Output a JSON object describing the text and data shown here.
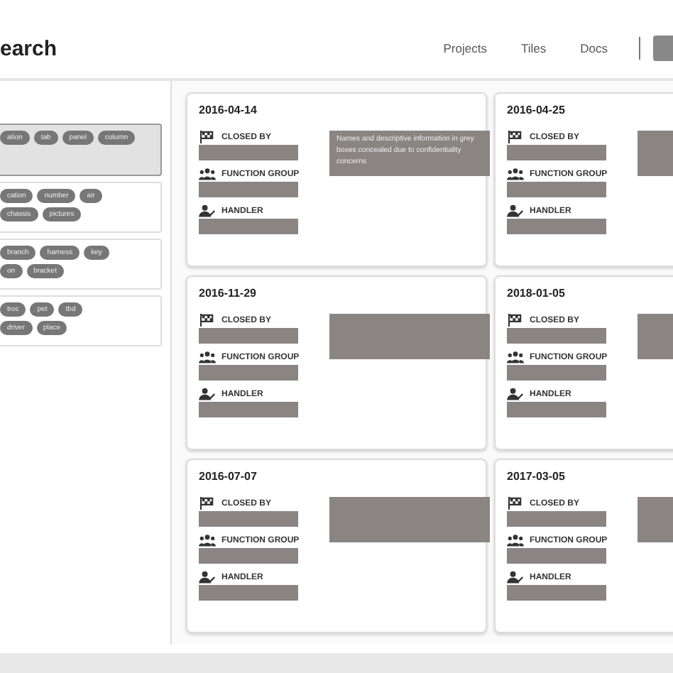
{
  "header": {
    "title": "earch",
    "nav": [
      "Projects",
      "Tiles",
      "Docs"
    ]
  },
  "tag_groups": [
    {
      "selected": true,
      "rows": [
        [
          "ation",
          "tab",
          "panel",
          "column"
        ]
      ]
    },
    {
      "selected": false,
      "rows": [
        [
          "cation",
          "number",
          "air"
        ],
        [
          "chassis",
          "pictures"
        ]
      ]
    },
    {
      "selected": false,
      "rows": [
        [
          "branch",
          "harness",
          "key"
        ],
        [
          "on",
          "bracket"
        ]
      ]
    },
    {
      "selected": false,
      "rows": [
        [
          "troc",
          "pet",
          "tbd"
        ],
        [
          "driver",
          "place"
        ]
      ]
    }
  ],
  "cards": [
    {
      "date": "2016-04-14",
      "fields": [
        {
          "kind": "flag",
          "label": "CLOSED BY"
        },
        {
          "kind": "group",
          "label": "FUNCTION GROUP"
        },
        {
          "kind": "person",
          "label": "HANDLER"
        }
      ],
      "note": "Names and descriptive information in grey boxes concealed due to confidentiality concerns"
    },
    {
      "date": "2016-04-25",
      "fields": [
        {
          "kind": "flag",
          "label": "CLOSED BY"
        },
        {
          "kind": "group",
          "label": "FUNCTION GROUP"
        },
        {
          "kind": "person",
          "label": "HANDLER"
        }
      ]
    },
    {
      "date": "2016-11-29",
      "fields": [
        {
          "kind": "flag",
          "label": "CLOSED BY"
        },
        {
          "kind": "group",
          "label": "FUNCTION GROUP"
        },
        {
          "kind": "person",
          "label": "HANDLER"
        }
      ]
    },
    {
      "date": "2018-01-05",
      "fields": [
        {
          "kind": "flag",
          "label": "CLOSED BY"
        },
        {
          "kind": "group",
          "label": "FUNCTION GROUP"
        },
        {
          "kind": "person",
          "label": "HANDLER"
        }
      ]
    },
    {
      "date": "2016-07-07",
      "fields": [
        {
          "kind": "flag",
          "label": "CLOSED BY"
        },
        {
          "kind": "group",
          "label": "FUNCTION GROUP"
        },
        {
          "kind": "person",
          "label": "HANDLER"
        }
      ]
    },
    {
      "date": "2017-03-05",
      "fields": [
        {
          "kind": "flag",
          "label": "CLOSED BY"
        },
        {
          "kind": "group",
          "label": "FUNCTION GROUP"
        },
        {
          "kind": "person",
          "label": "HANDLER"
        }
      ]
    }
  ]
}
